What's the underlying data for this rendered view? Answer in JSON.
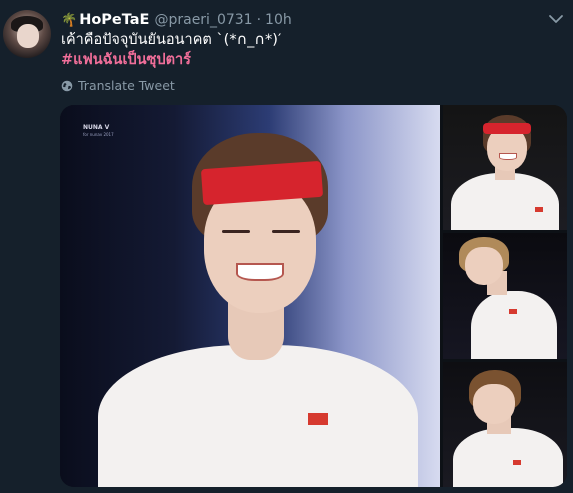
{
  "tweet": {
    "display_name": "HoPeTaE",
    "name_emoji": "🌴",
    "handle": "@praeri_0731",
    "separator": "·",
    "time": "10h",
    "text": "เค้าคือปัจจุบันยันอนาคต  `(*∩_∩*)′",
    "hashtag": "#แฟนฉันเป็นซุปตาร์",
    "translate_label": "Translate Tweet"
  },
  "media": {
    "watermark_title": "NUNA V",
    "watermark_sub": "for nunav 2017"
  },
  "colors": {
    "background": "#15202b",
    "secondary_text": "#8899a6",
    "hashtag": "#f06e99"
  },
  "icons": {
    "menu": "chevron-down-icon",
    "translate": "globe-icon"
  }
}
